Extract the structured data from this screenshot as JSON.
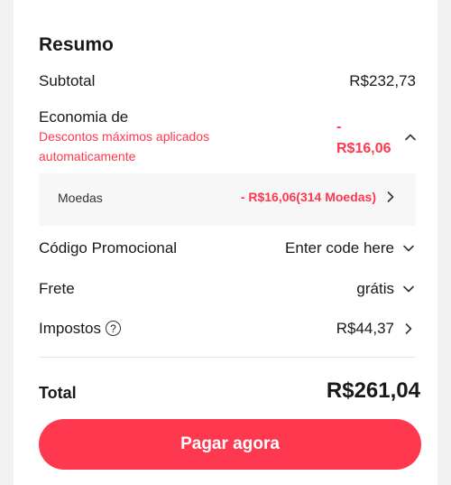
{
  "summary": {
    "title": "Resumo",
    "subtotal_label": "Subtotal",
    "subtotal_value": "R$232,73",
    "savings_label": "Economia de",
    "savings_sub": "Descontos máximos aplicados automaticamente",
    "savings_value_line1": "-",
    "savings_value_line2": "R$16,06",
    "coins_label": "Moedas",
    "coins_value": "- R$16,06(314 Moedas)",
    "promo_label": "Código Promocional",
    "promo_value": "Enter code here",
    "shipping_label": "Frete",
    "shipping_value": "grátis",
    "taxes_label": "Impostos",
    "taxes_help": "?",
    "taxes_value": "R$44,37",
    "total_label": "Total",
    "total_value": "R$261,04",
    "pay_button": "Pagar agora"
  },
  "colors": {
    "accent": "#fd384f",
    "text": "#191919",
    "panel": "#f7f7f7"
  },
  "icons": {
    "savings_toggle": "chevron-up-icon",
    "coins_toggle": "chevron-right-icon",
    "promo_toggle": "chevron-down-icon",
    "shipping_toggle": "chevron-down-icon",
    "taxes_toggle": "chevron-right-icon",
    "taxes_help": "question-circle-icon"
  }
}
